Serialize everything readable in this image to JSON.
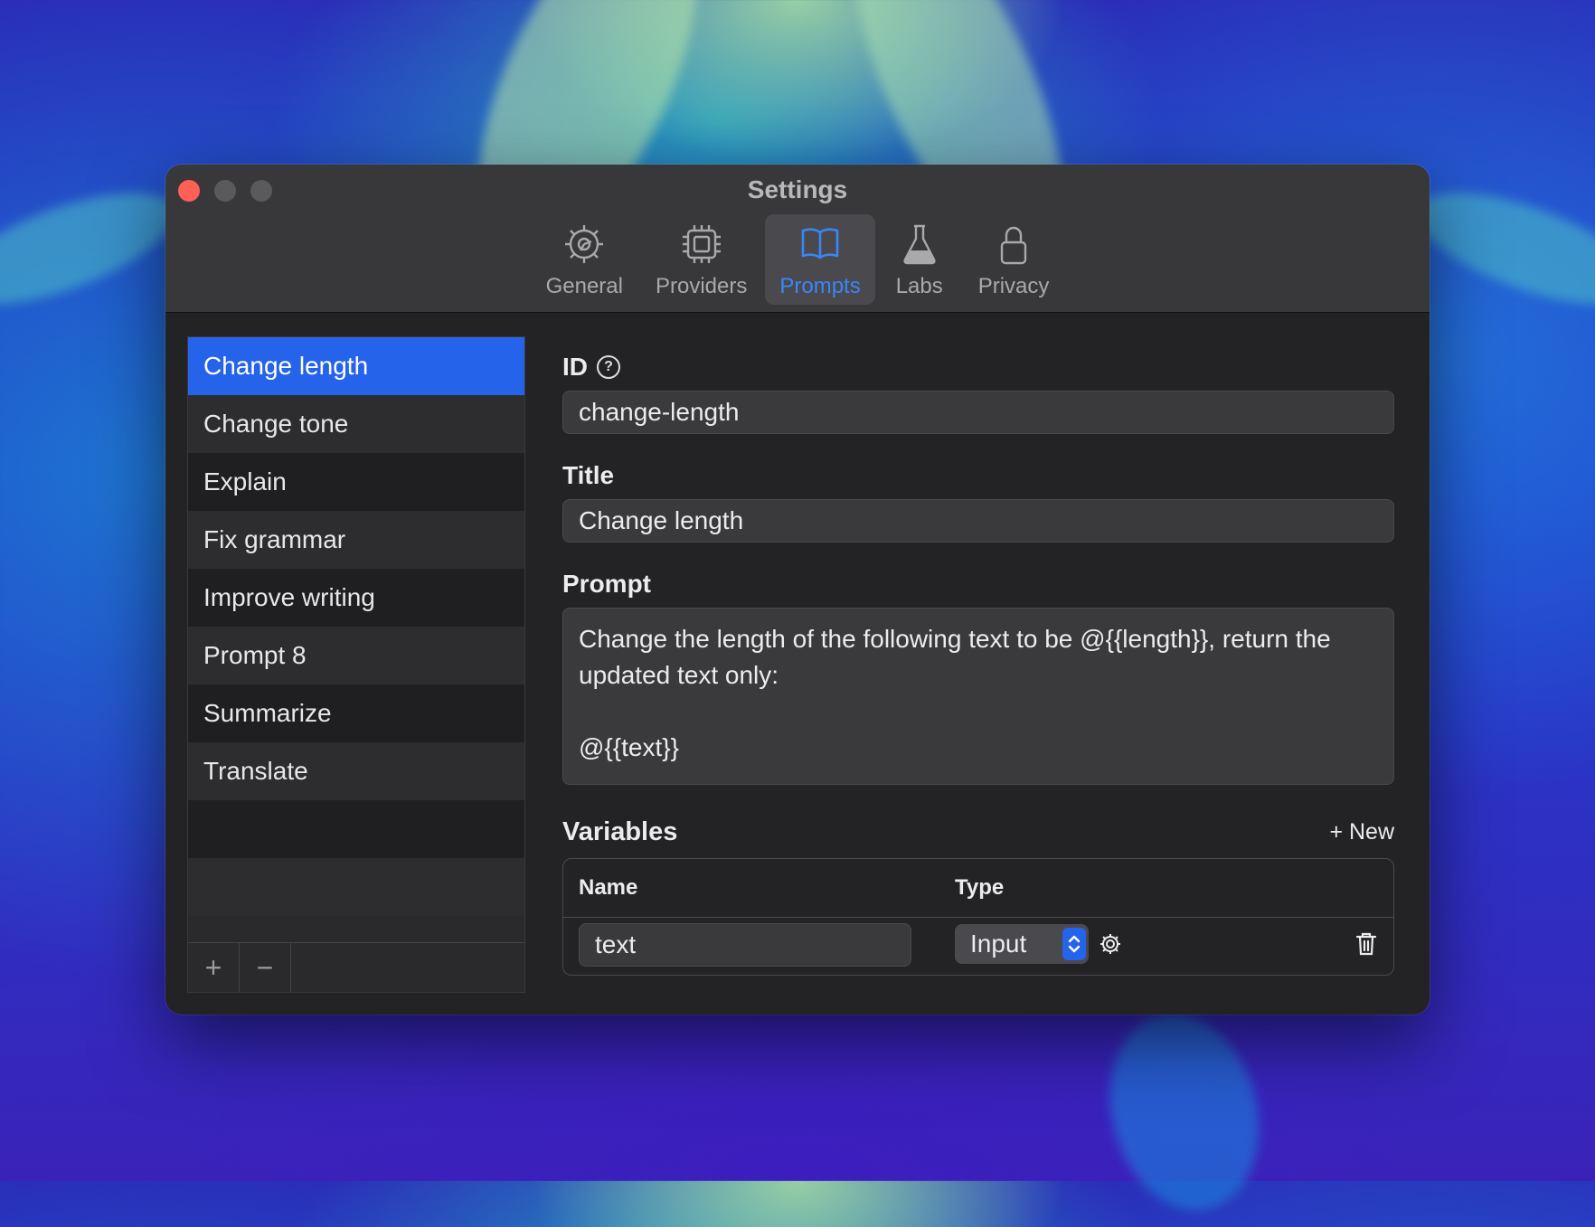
{
  "window": {
    "title": "Settings"
  },
  "tabs": [
    {
      "label": "General",
      "icon": "gear-icon"
    },
    {
      "label": "Providers",
      "icon": "chip-icon"
    },
    {
      "label": "Prompts",
      "icon": "book-icon",
      "active": true
    },
    {
      "label": "Labs",
      "icon": "flask-icon"
    },
    {
      "label": "Privacy",
      "icon": "lock-icon"
    }
  ],
  "sidebar": {
    "items": [
      "Change length",
      "Change tone",
      "Explain",
      "Fix grammar",
      "Improve writing",
      "Prompt 8",
      "Summarize",
      "Translate"
    ],
    "selected": "Change length",
    "add_label": "+",
    "remove_label": "−"
  },
  "form": {
    "id_label": "ID",
    "id_value": "change-length",
    "title_label": "Title",
    "title_value": "Change length",
    "prompt_label": "Prompt",
    "prompt_value": "Change the length of the following text to be @{{length}}, return the updated text only:\n\n@{{text}}"
  },
  "variables": {
    "title": "Variables",
    "new_label": "+ New",
    "columns": {
      "name": "Name",
      "type": "Type"
    },
    "rows": [
      {
        "name": "text",
        "type": "Input"
      }
    ]
  },
  "colors": {
    "accent": "#2563eb",
    "active_tab": "#3a86f7",
    "close": "#fe5f57"
  }
}
